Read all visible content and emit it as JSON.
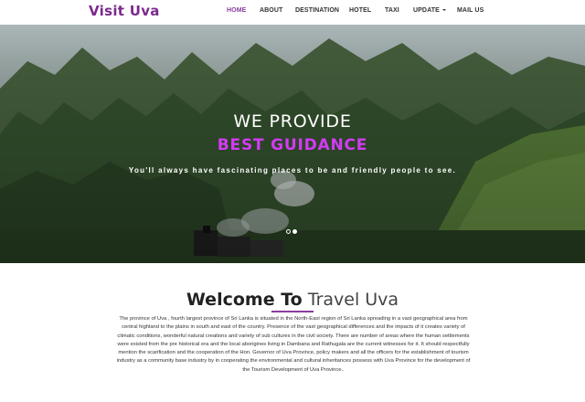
{
  "brand": "Visit Uva",
  "nav": {
    "items": [
      {
        "label": "HOME",
        "active": true
      },
      {
        "label": "ABOUT"
      },
      {
        "label": "DESTINATION"
      },
      {
        "label": "HOTEL"
      },
      {
        "label": "TAXI"
      },
      {
        "label": "UPDATE"
      },
      {
        "label": "MAIL US"
      }
    ]
  },
  "hero": {
    "title": "WE PROVIDE",
    "highlight": "BEST GUIDANCE",
    "tagline": "You'll always have fascinating places to be and friendly people to see.",
    "slides": 2,
    "active_slide": 1
  },
  "welcome": {
    "title_bold": "Welcome To",
    "title_light": "Travel Uva",
    "paragraph": "The province of Uva , fourth largest province of Sri Lanka is situated in the North-East region of Sri Lanka spreading in a vast geographical area from central highland to the plains in south and east of the country. Presence of the vast geographical differences and the impacts of it creates variety of climatic conditions, wonderful natural creations and variety of sub cultures in the civil society. There are number of areas where the human settlements were existed from the pre historical era and the local aborigines living in Dambana and Rathugala are the current witnesses for it. It should respectfully mention the scarification and the cooperation of the Hon. Governor of Uva Province, policy makers and all the officers for the establishment of tourism industry as a community base industry by in cooperating the environmental and cultural inheritances possess with Uva Province for the development of the Tourism Development of Uva Province.."
  },
  "colors": {
    "brand": "#7b2a8c",
    "accent": "#8a3d9e",
    "highlight": "#d33bf5"
  }
}
